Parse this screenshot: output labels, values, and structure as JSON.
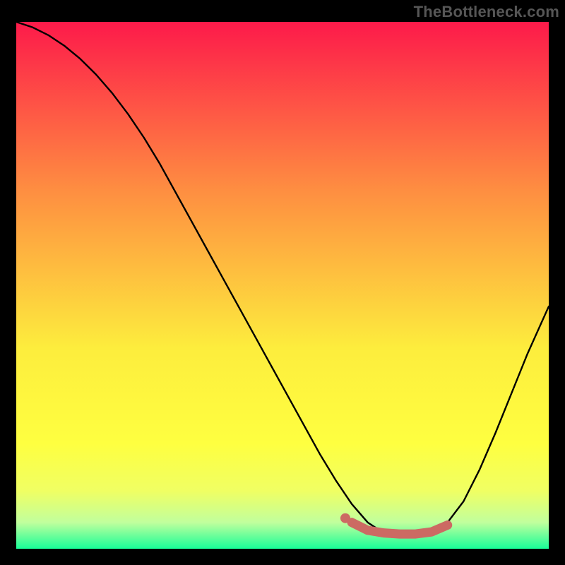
{
  "attribution": "TheBottleneck.com",
  "colors": {
    "page_bg": "#000000",
    "curve": "#000000",
    "marker": "#cc6a63",
    "grad_top": "#fd1a4a",
    "grad_mid1": "#fe8e41",
    "grad_mid2": "#fded3d",
    "grad_mid3": "#feff40",
    "grad_low1": "#f0ff63",
    "grad_low2": "#c1ff9d",
    "grad_bottom": "#18fe98"
  },
  "chart_data": {
    "type": "line",
    "title": "",
    "xlabel": "",
    "ylabel": "",
    "xlim": [
      0,
      100
    ],
    "ylim": [
      0,
      100
    ],
    "x": [
      0,
      3,
      6,
      9,
      12,
      15,
      18,
      21,
      24,
      27,
      30,
      33,
      36,
      39,
      42,
      45,
      48,
      51,
      54,
      57,
      60,
      63,
      66,
      69,
      72,
      75,
      78,
      81,
      84,
      87,
      90,
      93,
      96,
      100
    ],
    "values": [
      100,
      99,
      97.5,
      95.5,
      93,
      90,
      86.5,
      82.5,
      78,
      73,
      67.5,
      62,
      56.5,
      51,
      45.5,
      40,
      34.5,
      29,
      23.5,
      18,
      13,
      8.5,
      5,
      3,
      2.5,
      2.5,
      3,
      5,
      9,
      15,
      22,
      29.5,
      37,
      46
    ],
    "markers": {
      "x": [
        63,
        66,
        69,
        72,
        75,
        78,
        81
      ],
      "y": [
        5,
        3.5,
        3,
        2.8,
        2.8,
        3.2,
        4.5
      ]
    }
  }
}
